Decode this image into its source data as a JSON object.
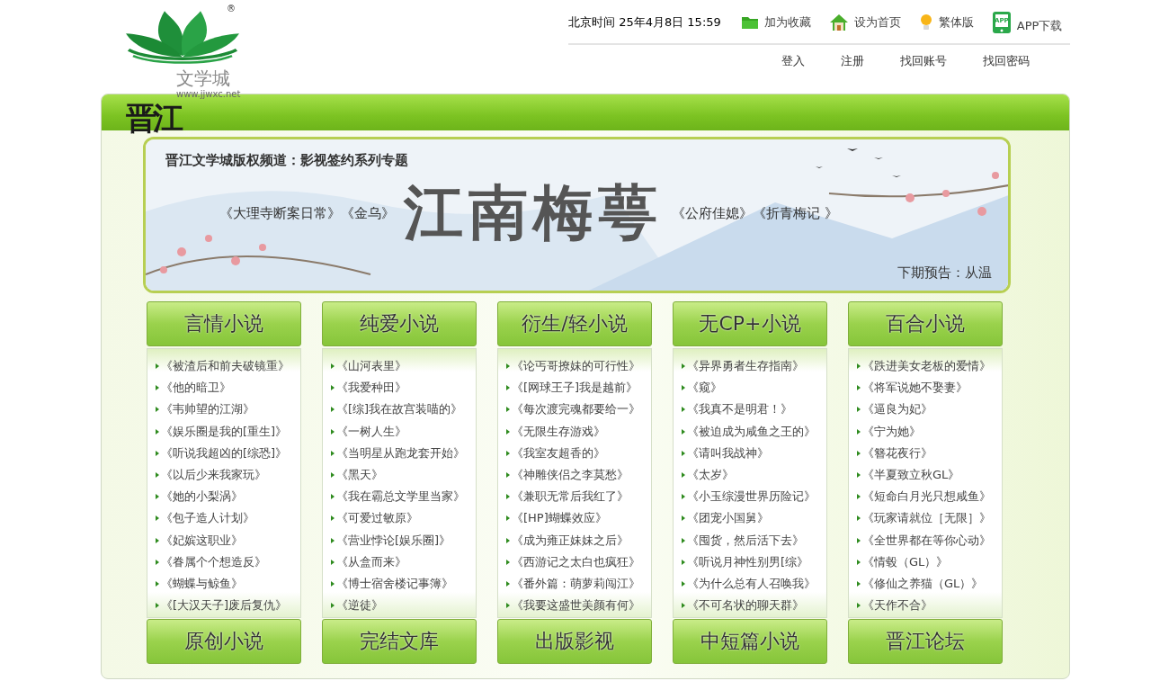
{
  "logo": {
    "mark": "®",
    "name": "文学城",
    "url": "www.jjwxc.net",
    "brand": "晋江"
  },
  "header": {
    "clock": "北京时间 25年4月8日 15:59",
    "links": [
      {
        "kind": "favorite",
        "label": "加为收藏"
      },
      {
        "kind": "home",
        "label": "设为首页"
      },
      {
        "kind": "traditional",
        "label": "繁体版"
      },
      {
        "kind": "app",
        "label": "APP下载",
        "badge": "APP"
      }
    ],
    "account_links": [
      "登入",
      "注册",
      "找回账号",
      "找回密码"
    ]
  },
  "banner": {
    "channel": "晋江文学城版权频道：影视签约系列专题",
    "left_titles": "《大理寺断案日常》《金乌》",
    "author": "江南梅萼",
    "right_titles": "《公府佳媳》《折青梅记 》",
    "next": "下期预告：从温"
  },
  "columns": [
    {
      "heading": "言情小说",
      "footer": "原创小说",
      "items": [
        "《被渣后和前夫破镜重》",
        "《他的暗卫》",
        "《韦帅望的江湖》",
        "《娱乐圈是我的[重生]》",
        "《听说我超凶的[综恐]》",
        "《以后少来我家玩》",
        "《她的小梨涡》",
        "《包子造人计划》",
        "《妃嫔这职业》",
        "《眷属个个想造反》",
        "《蝴蝶与鲸鱼》",
        "《[大汉天子]废后复仇》"
      ]
    },
    {
      "heading": "纯爱小说",
      "footer": "完结文库",
      "items": [
        "《山河表里》",
        "《我爱种田》",
        "《[综]我在故宫装喵的》",
        "《一树人生》",
        "《当明星从跑龙套开始》",
        "《黑天》",
        "《我在霸总文学里当家》",
        "《可爱过敏原》",
        "《营业悖论[娱乐圈]》",
        "《从盒而来》",
        "《博士宿舍楼记事簿》",
        "《逆徒》"
      ]
    },
    {
      "heading": "衍生/轻小说",
      "footer": "出版影视",
      "items": [
        "《论丐哥撩妹的可行性》",
        "《[网球王子]我是越前》",
        "《每次渡完魂都要给一》",
        "《无限生存游戏》",
        "《我室友超香的》",
        "《神雕侠侣之李莫愁》",
        "《兼职无常后我红了》",
        "《[HP]蝴蝶效应》",
        "《成为雍正妹妹之后》",
        "《西游记之太白也疯狂》",
        "《番外篇：萌萝莉闯江》",
        "《我要这盛世美颜有何》"
      ]
    },
    {
      "heading": "无CP+小说",
      "footer": "中短篇小说",
      "items": [
        "《异界勇者生存指南》",
        "《窥》",
        "《我真不是明君！》",
        "《被迫成为咸鱼之王的》",
        "《请叫我战神》",
        "《太岁》",
        "《小玉综漫世界历险记》",
        "《团宠小国舅》",
        "《囤货，然后活下去》",
        "《听说月神性别男[综》",
        "《为什么总有人召唤我》",
        "《不可名状的聊天群》"
      ]
    },
    {
      "heading": "百合小说",
      "footer": "晋江论坛",
      "items": [
        "《跌进美女老板的爱情》",
        "《将军说她不娶妻》",
        "《逼良为妃》",
        "《宁为她》",
        "《簪花夜行》",
        "《半夏致立秋GL》",
        "《短命白月光只想咸鱼》",
        "《玩家请就位［无限］》",
        "《全世界都在等你心动》",
        "《情毂（GL）》",
        "《修仙之养猫（GL）》",
        "《天作不合》"
      ]
    }
  ]
}
